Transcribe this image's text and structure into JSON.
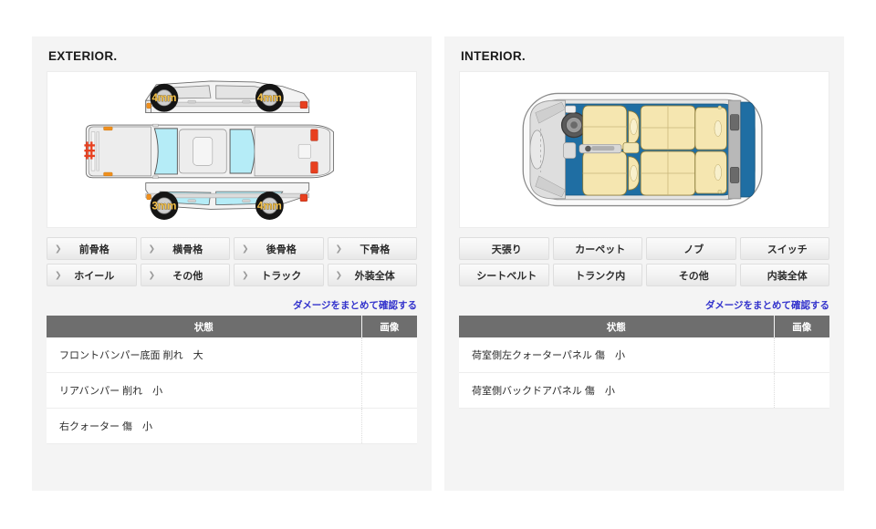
{
  "exterior": {
    "title": "EXTERIOR.",
    "diagram": {
      "name": "exterior-car-diagram",
      "tires": [
        {
          "position": "front-left",
          "label": "4mm"
        },
        {
          "position": "front-right",
          "label": "4mm"
        },
        {
          "position": "rear-left",
          "label": "3mm"
        },
        {
          "position": "rear-right",
          "label": "4mm"
        }
      ],
      "colors": {
        "body": "#f0f0f0",
        "glass": "#b5ecf7",
        "accent": "#f0901e",
        "marker": "#e8401f",
        "tire": "#151515",
        "tire_label": "#f2c14e"
      }
    },
    "buttons": [
      "前骨格",
      "横骨格",
      "後骨格",
      "下骨格",
      "ホイール",
      "その他",
      "トラック",
      "外装全体"
    ],
    "bulk_link": "ダメージをまとめて確認する",
    "table": {
      "headers": [
        "状態",
        "画像"
      ],
      "rows": [
        {
          "state": "フロントバンパー底面 削れ　大",
          "image": ""
        },
        {
          "state": "リアバンパー 削れ　小",
          "image": ""
        },
        {
          "state": "右クォーター 傷　小",
          "image": ""
        }
      ]
    }
  },
  "interior": {
    "title": "INTERIOR.",
    "diagram": {
      "name": "interior-car-diagram",
      "colors": {
        "body": "#e6e6e6",
        "floor": "#1f6ea3",
        "seat": "#f5e6b0",
        "cargo": "#b8b8b8",
        "outline": "#555555"
      }
    },
    "buttons": [
      "天張り",
      "カーペット",
      "ノブ",
      "スイッチ",
      "シートベルト",
      "トランク内",
      "その他",
      "内装全体"
    ],
    "bulk_link": "ダメージをまとめて確認する",
    "table": {
      "headers": [
        "状態",
        "画像"
      ],
      "rows": [
        {
          "state": "荷室側左クォーターパネル 傷　小",
          "image": ""
        },
        {
          "state": "荷室側バックドアパネル 傷　小",
          "image": ""
        }
      ]
    }
  }
}
